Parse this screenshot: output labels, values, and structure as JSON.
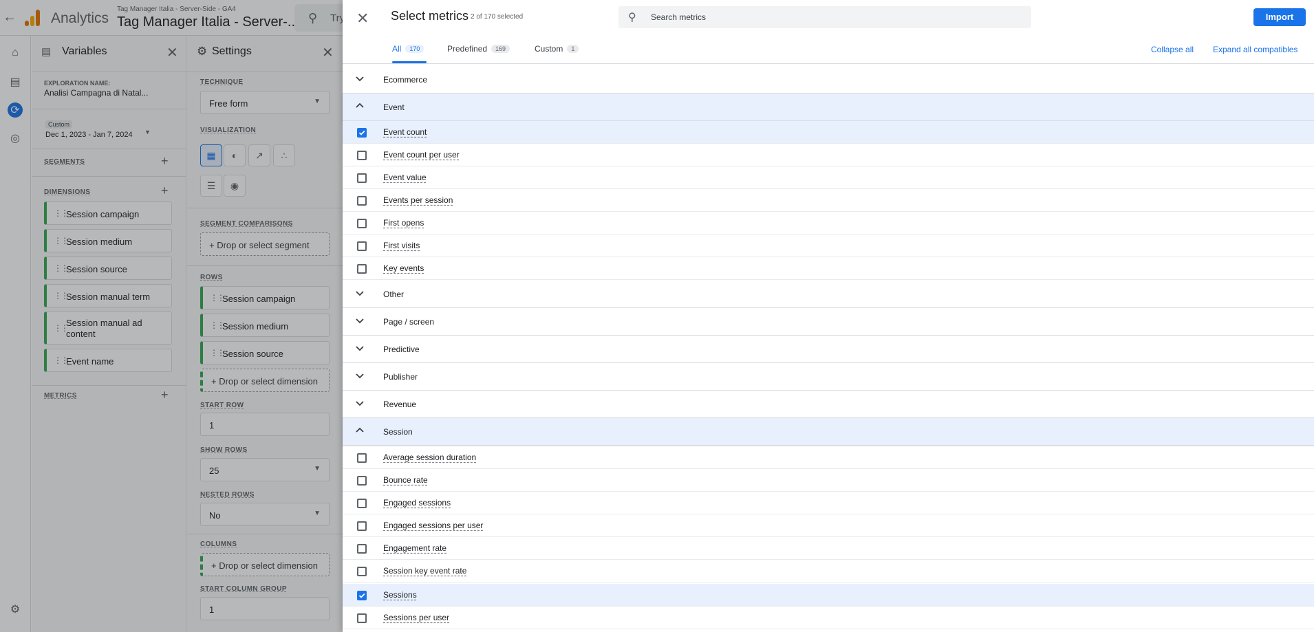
{
  "app": {
    "name": "Analytics",
    "account_path": "Tag Manager Italia - Server-Side - GA4",
    "account_name": "Tag Manager Italia - Server-...",
    "search_placeholder": "Try"
  },
  "variables_panel": {
    "title": "Variables",
    "exploration_label": "EXPLORATION NAME:",
    "exploration_name": "Analisi Campagna di Natal...",
    "date_tag": "Custom",
    "date_range": "Dec 1, 2023 - Jan 7, 2024",
    "segments_label": "SEGMENTS",
    "dimensions_label": "DIMENSIONS",
    "dimensions": [
      "Session campaign",
      "Session medium",
      "Session source",
      "Session manual term",
      "Session manual ad content",
      "Event name"
    ],
    "metrics_label": "METRICS"
  },
  "settings_panel": {
    "title": "Settings",
    "technique_label": "TECHNIQUE",
    "technique_value": "Free form",
    "visualization_label": "VISUALIZATION",
    "segment_comparisons_label": "SEGMENT COMPARISONS",
    "drop_segment": "Drop or select segment",
    "rows_label": "ROWS",
    "rows": [
      "Session campaign",
      "Session medium",
      "Session source"
    ],
    "drop_dimension": "Drop or select dimension",
    "start_row_label": "START ROW",
    "start_row_value": "1",
    "show_rows_label": "SHOW ROWS",
    "show_rows_value": "25",
    "nested_rows_label": "NESTED ROWS",
    "nested_rows_value": "No",
    "columns_label": "COLUMNS",
    "drop_column_dimension": "Drop or select dimension",
    "start_column_group_label": "START COLUMN GROUP",
    "start_column_group_value": "1"
  },
  "drawer": {
    "title": "Select metrics",
    "selected_count": "2 of 170 selected",
    "search_placeholder": "Search metrics",
    "import_label": "Import",
    "tabs": [
      {
        "label": "All",
        "count": "170"
      },
      {
        "label": "Predefined",
        "count": "169"
      },
      {
        "label": "Custom",
        "count": "1"
      }
    ],
    "collapse_all": "Collapse all",
    "expand_all": "Expand all compatibles",
    "categories": {
      "ecommerce": "Ecommerce",
      "event": "Event",
      "other": "Other",
      "page_screen": "Page / screen",
      "predictive": "Predictive",
      "publisher": "Publisher",
      "revenue": "Revenue",
      "session": "Session"
    },
    "event_metrics": [
      {
        "label": "Event count",
        "checked": true
      },
      {
        "label": "Event count per user",
        "checked": false
      },
      {
        "label": "Event value",
        "checked": false
      },
      {
        "label": "Events per session",
        "checked": false
      },
      {
        "label": "First opens",
        "checked": false
      },
      {
        "label": "First visits",
        "checked": false
      },
      {
        "label": "Key events",
        "checked": false
      }
    ],
    "session_metrics": [
      {
        "label": "Average session duration",
        "checked": false
      },
      {
        "label": "Bounce rate",
        "checked": false
      },
      {
        "label": "Engaged sessions",
        "checked": false
      },
      {
        "label": "Engaged sessions per user",
        "checked": false
      },
      {
        "label": "Engagement rate",
        "checked": false
      },
      {
        "label": "Session key event rate",
        "checked": false
      },
      {
        "label": "Sessions",
        "checked": true
      },
      {
        "label": "Sessions per user",
        "checked": false
      }
    ]
  },
  "colors": {
    "accent": "#1a73e8",
    "selected_row": "#e8f0fe",
    "dimension_chip": "#34a853"
  },
  "icons": {
    "home": "home-icon",
    "reports": "bar-chart-icon",
    "explore": "explore-icon",
    "advertising": "target-icon",
    "settings": "gear-icon"
  }
}
